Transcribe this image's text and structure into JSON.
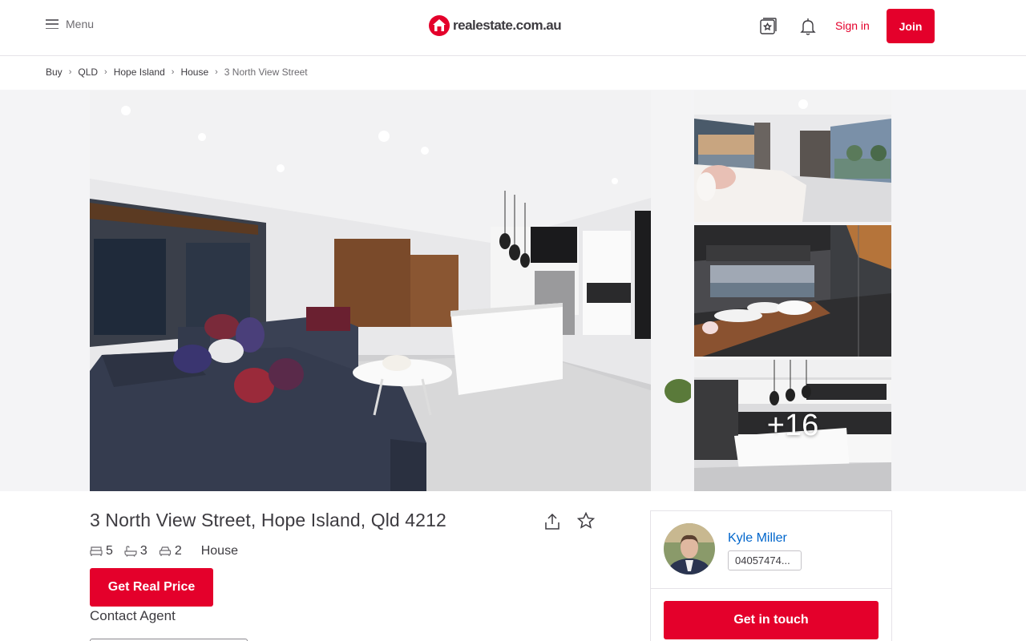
{
  "header": {
    "menu_label": "Menu",
    "logo_text": "realestate.com.au",
    "signin_label": "Sign in",
    "join_label": "Join"
  },
  "breadcrumb": [
    "Buy",
    "QLD",
    "Hope Island",
    "House",
    "3 North View Street"
  ],
  "gallery": {
    "more_count": "+16"
  },
  "listing": {
    "address": "3 North View Street, Hope Island, Qld 4212",
    "bedrooms": "5",
    "bathrooms": "3",
    "parking": "2",
    "property_type": "House",
    "real_price_label": "Get Real Price",
    "contact_label": "Contact Agent"
  },
  "agent": {
    "name": "Kyle Miller",
    "phone": "04057474...",
    "cta_label": "Get in touch"
  },
  "colors": {
    "brand_red": "#e4002b",
    "link_blue": "#0066cc",
    "text_dark": "#3d3b40"
  },
  "icons": [
    "menu-icon",
    "logo-house-icon",
    "saved-properties-icon",
    "bell-icon",
    "chevron-right-icon",
    "share-icon",
    "star-icon",
    "bed-icon",
    "bath-icon",
    "car-icon"
  ]
}
